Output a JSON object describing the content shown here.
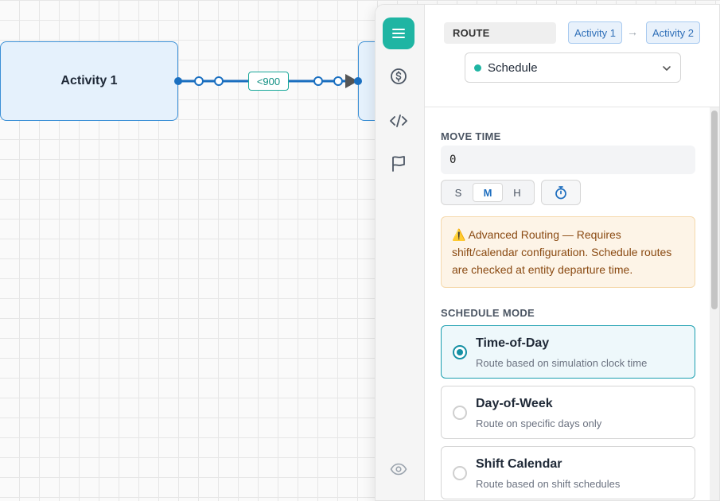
{
  "canvas": {
    "node_from": "Activity 1",
    "edge_label": "<900"
  },
  "panel": {
    "route_tag": "ROUTE",
    "from_activity": "Activity 1",
    "arrow": "→",
    "to_activity": "Activity 2",
    "route_type": {
      "selected": "Schedule",
      "status_color": "#1fb5a3"
    },
    "move_time": {
      "label": "MOVE TIME",
      "value": "0",
      "units": [
        "S",
        "M",
        "H"
      ],
      "selected_unit": "M"
    },
    "warning": {
      "icon": "⚠️",
      "text": "Advanced Routing — Requires shift/calendar configuration. Schedule routes are checked at entity departure time."
    },
    "schedule_mode": {
      "label": "SCHEDULE MODE",
      "options": [
        {
          "title": "Time-of-Day",
          "desc": "Route based on simulation clock time",
          "selected": true
        },
        {
          "title": "Day-of-Week",
          "desc": "Route on specific days only",
          "selected": false
        },
        {
          "title": "Shift Calendar",
          "desc": "Route based on shift schedules",
          "selected": false
        }
      ]
    }
  },
  "rail_icons": [
    "menu-icon",
    "dollar-icon",
    "code-icon",
    "flag-icon",
    "eye-icon"
  ],
  "colors": {
    "accent": "#1fb5a3",
    "edge": "#1a6fc0",
    "node_fill": "#e5f1fc"
  }
}
